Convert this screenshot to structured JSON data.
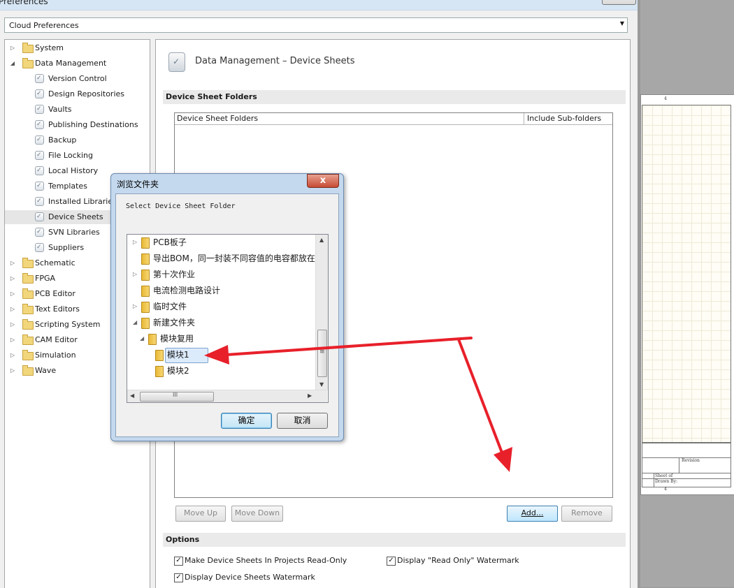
{
  "window": {
    "title": "Preferences"
  },
  "preference_set": {
    "selected": "Cloud Preferences"
  },
  "tree": {
    "items": [
      {
        "label": "System",
        "type": "folder",
        "expanded": false
      },
      {
        "label": "Data Management",
        "type": "folder",
        "expanded": true
      },
      {
        "label": "Version Control",
        "type": "page"
      },
      {
        "label": "Design Repositories",
        "type": "page"
      },
      {
        "label": "Vaults",
        "type": "page"
      },
      {
        "label": "Publishing Destinations",
        "type": "page"
      },
      {
        "label": "Backup",
        "type": "page"
      },
      {
        "label": "File Locking",
        "type": "page"
      },
      {
        "label": "Local History",
        "type": "page"
      },
      {
        "label": "Templates",
        "type": "page"
      },
      {
        "label": "Installed Libraries",
        "type": "page"
      },
      {
        "label": "Device Sheets",
        "type": "page",
        "selected": true
      },
      {
        "label": "SVN Libraries",
        "type": "page"
      },
      {
        "label": "Suppliers",
        "type": "page"
      },
      {
        "label": "Schematic",
        "type": "folder",
        "expanded": false
      },
      {
        "label": "FPGA",
        "type": "folder",
        "expanded": false
      },
      {
        "label": "PCB Editor",
        "type": "folder",
        "expanded": false
      },
      {
        "label": "Text Editors",
        "type": "folder",
        "expanded": false
      },
      {
        "label": "Scripting System",
        "type": "folder",
        "expanded": false
      },
      {
        "label": "CAM Editor",
        "type": "folder",
        "expanded": false
      },
      {
        "label": "Simulation",
        "type": "folder",
        "expanded": false
      },
      {
        "label": "Wave",
        "type": "folder",
        "expanded": false
      }
    ]
  },
  "panel": {
    "title": "Data Management – Device Sheets",
    "folders_section": "Device Sheet Folders",
    "columns": [
      "Device Sheet Folders",
      "Include Sub-folders"
    ],
    "buttons": {
      "move_up": "Move Up",
      "move_down": "Move Down",
      "add": "Add...",
      "remove": "Remove"
    },
    "options_section": "Options",
    "options": [
      {
        "label": "Make Device Sheets In Projects Read-Only",
        "checked": true
      },
      {
        "label": "Display \"Read Only\" Watermark",
        "checked": true
      },
      {
        "label": "Display Device Sheets Watermark",
        "checked": true
      }
    ]
  },
  "dialog": {
    "title": "浏览文件夹",
    "close": "x",
    "instruction": "Select Device Sheet Folder",
    "folders": [
      {
        "label": "PCB板子",
        "level": 0,
        "expander": "▷"
      },
      {
        "label": "导出BOM，同一封装不同容值的电容都放在",
        "level": 0,
        "expander": ""
      },
      {
        "label": "第十次作业",
        "level": 0,
        "expander": "▷"
      },
      {
        "label": "电流检测电路设计",
        "level": 0,
        "expander": ""
      },
      {
        "label": "临时文件",
        "level": 0,
        "expander": "▷"
      },
      {
        "label": "新建文件夹",
        "level": 0,
        "expander": "◢"
      },
      {
        "label": "模块复用",
        "level": 1,
        "expander": "◢"
      },
      {
        "label": "模块1",
        "level": 2,
        "expander": "",
        "selected": true
      },
      {
        "label": "模块2",
        "level": 2,
        "expander": ""
      }
    ],
    "hscroll_glyph": "III",
    "vscroll_glyph": "≡",
    "ok": "确定",
    "cancel": "取消"
  },
  "background_sheet": {
    "column_number": "4",
    "revision_label": "Revision",
    "sheet_label": "Sheet   of",
    "drawn_by_label": "Drawn By:"
  },
  "colors": {
    "annotation_arrow": "#e8202a",
    "selection": "#dcebfc",
    "section_bar": "#eaeaea"
  }
}
